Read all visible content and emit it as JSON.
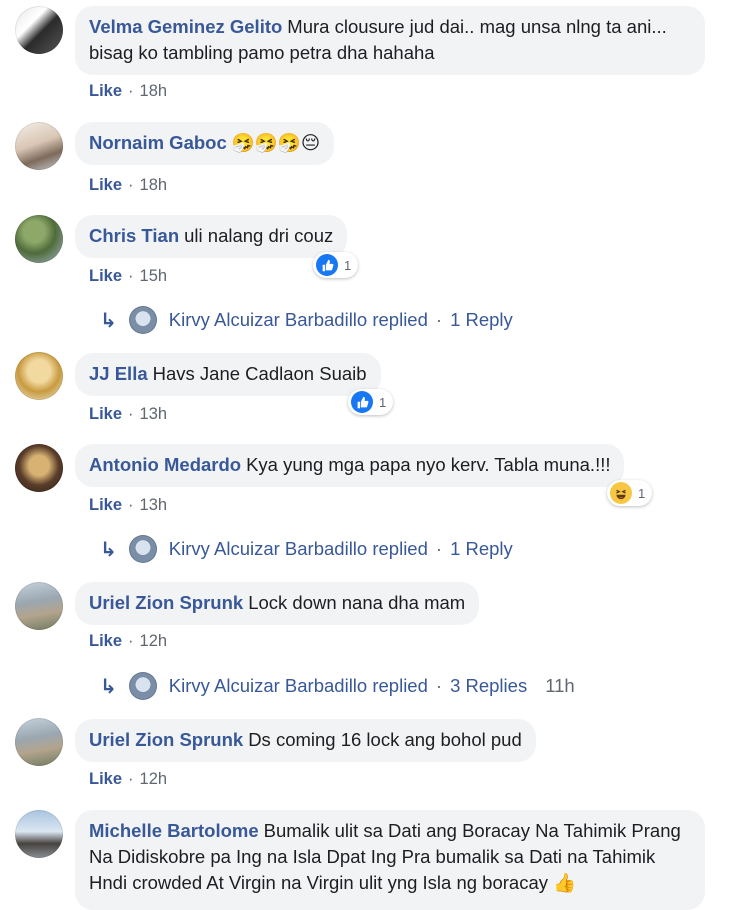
{
  "comments": [
    {
      "name": "Velma Geminez Gelito",
      "text": "Mura clousure jud dai.. mag unsa nlng ta ani... bisag ko tambling pamo petra dha hahaha",
      "like": "Like",
      "time": "18h"
    },
    {
      "name": "Nornaim Gaboc",
      "text": "🤧🤧🤧😔",
      "like": "Like",
      "time": "18h"
    },
    {
      "name": "Chris Tian",
      "text": "uli nalang dri couz",
      "like": "Like",
      "time": "15h",
      "reaction_count": "1"
    },
    {
      "name": "JJ Ella",
      "text": "Havs Jane Cadlaon Suaib",
      "like": "Like",
      "time": "13h",
      "reaction_count": "1"
    },
    {
      "name": "Antonio Medardo",
      "text": "Kya yung mga papa nyo kerv. Tabla muna.!!!",
      "like": "Like",
      "time": "13h",
      "reaction_count": "1"
    },
    {
      "name": "Uriel Zion Sprunk",
      "text": "Lock down nana dha mam",
      "like": "Like",
      "time": "12h"
    },
    {
      "name": "Uriel Zion Sprunk",
      "text": "Ds coming 16 lock ang bohol pud",
      "like": "Like",
      "time": "12h"
    },
    {
      "name": "Michelle Bartolome",
      "text": "Bumalik ulit sa Dati ang Boracay Na Tahimik Prang Na Didiskobre pa Ing na Isla Dpat Ing Pra bumalik sa Dati na Tahimik Hndi crowded At Virgin na Virgin ulit yng Isla ng boracay 👍"
    }
  ],
  "replies": [
    {
      "author": "Kirvy Alcuizar Barbadillo replied",
      "sep": "·",
      "label": "1 Reply"
    },
    {
      "author": "Kirvy Alcuizar Barbadillo replied",
      "sep": "·",
      "label": "1 Reply"
    },
    {
      "author": "Kirvy Alcuizar Barbadillo replied",
      "sep": "·",
      "label": "3 Replies",
      "time": "11h"
    }
  ],
  "icons": {
    "reply_arrow": "↳",
    "like_reaction": "thumbs-up",
    "haha_reaction": "laughing-face"
  },
  "colors": {
    "name": "#385898",
    "bubble": "#f2f3f5",
    "meta": "#606770",
    "like_blue": "#1877f2"
  }
}
